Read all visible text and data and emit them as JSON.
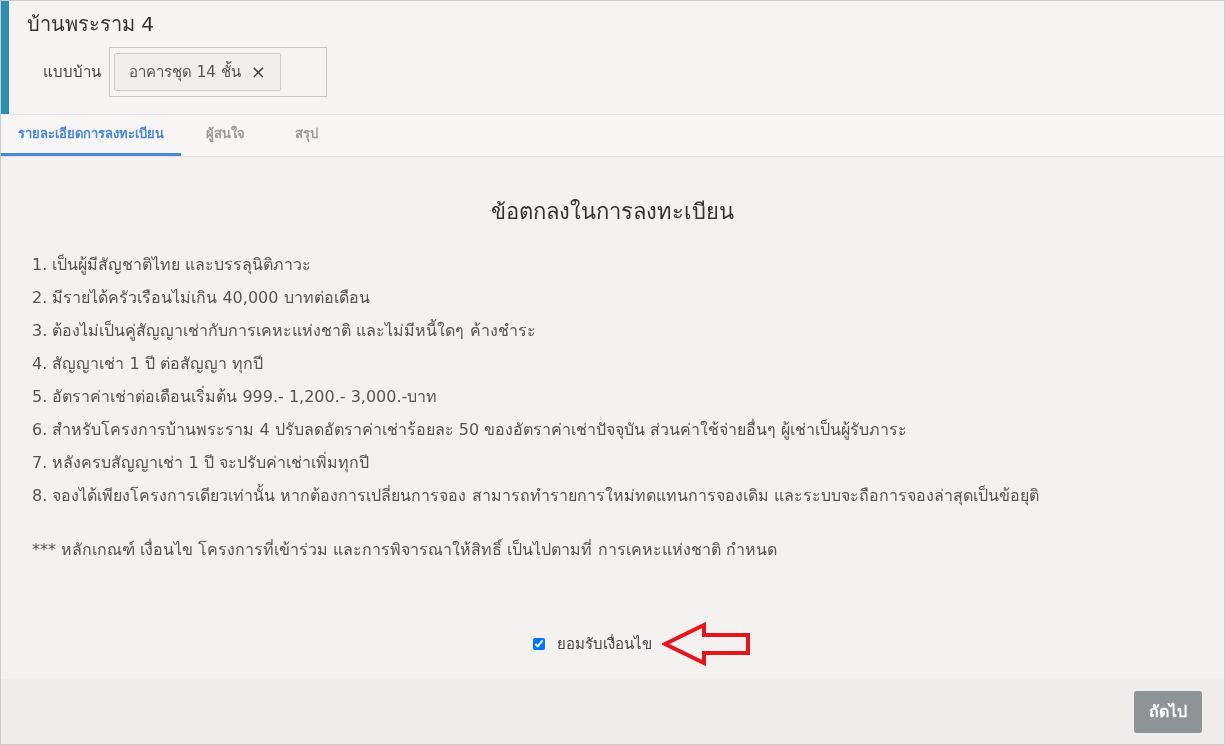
{
  "header": {
    "title": "บ้านพระราม 4",
    "field_label": "แบบบ้าน",
    "tags": [
      {
        "label": "อาคารชุด 14 ชั้น",
        "remove": "×"
      }
    ]
  },
  "tabs": [
    {
      "label": "รายละเอียดการลงทะเบียน",
      "selected": true
    },
    {
      "label": "ผู้สนใจ",
      "selected": false
    },
    {
      "label": "สรุป",
      "selected": false
    }
  ],
  "terms": {
    "heading": "ข้อตกลงในการลงทะเบียน",
    "items": [
      "1. เป็นผู้มีสัญชาติไทย และบรรลุนิติภาวะ",
      "2. มีรายได้ครัวเรือนไม่เกิน 40,000 บาทต่อเดือน",
      "3. ต้องไม่เป็นคู่สัญญาเช่ากับการเคหะแห่งชาติ และไม่มีหนี้ใดๆ ค้างชำระ",
      "4. สัญญาเช่า 1 ปี ต่อสัญญา ทุกปี",
      "5. อัตราค่าเช่าต่อเดือนเริ่มต้น 999.- 1,200.- 3,000.-บาท",
      "6. สำหรับโครงการบ้านพระราม 4 ปรับลดอัตราค่าเช่าร้อยละ 50 ของอัตราค่าเช่าปัจจุบัน ส่วนค่าใช้จ่ายอื่นๆ ผู้เช่าเป็นผู้รับภาระ",
      "7. หลังครบสัญญาเช่า 1 ปี จะปรับค่าเช่าเพิ่มทุกปี",
      "8. จองได้เพียงโครงการเดียวเท่านั้น หากต้องการเปลี่ยนการจอง สามารถทำรายการใหม่ทดแทนการจองเดิม และระบบจะถือการจองล่าสุดเป็นข้อยุติ"
    ],
    "note": "*** หลักเกณฑ์ เงื่อนไข โครงการที่เข้าร่วม และการพิจารณาให้สิทธิ์ เป็นไปตามที่ การเคหะแห่งชาติ กำหนด"
  },
  "accept": {
    "label": "ยอมรับเงื่อนไข",
    "checked": true
  },
  "footer": {
    "next_button": "ถัดไป"
  }
}
